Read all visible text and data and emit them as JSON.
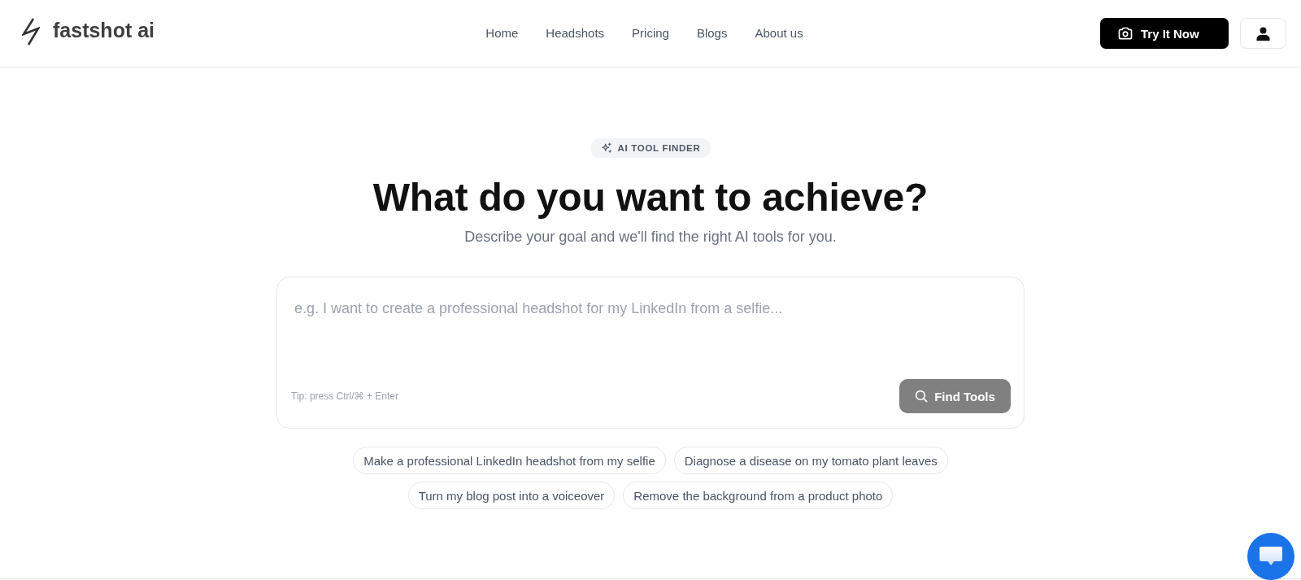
{
  "header": {
    "logo": "fastshot ai",
    "nav": [
      "Home",
      "Headshots",
      "Pricing",
      "Blogs",
      "About us"
    ],
    "cta": "Try It Now"
  },
  "hero": {
    "badge": "AI TOOL FINDER",
    "title": "What do you want to achieve?",
    "subtitle": "Describe your goal and we'll find the right AI tools for you."
  },
  "search": {
    "placeholder": "e.g. I want to create a professional headshot for my LinkedIn from a selfie...",
    "tip": "Tip: press Ctrl/⌘ + Enter",
    "button": {
      "label": "Find Tools",
      "disabled": true
    }
  },
  "suggestions": [
    "Make a professional LinkedIn headshot from my selfie",
    "Diagnose a disease on my tomato plant leaves",
    "Turn my blog post into a voiceover",
    "Remove the background from a product photo"
  ]
}
